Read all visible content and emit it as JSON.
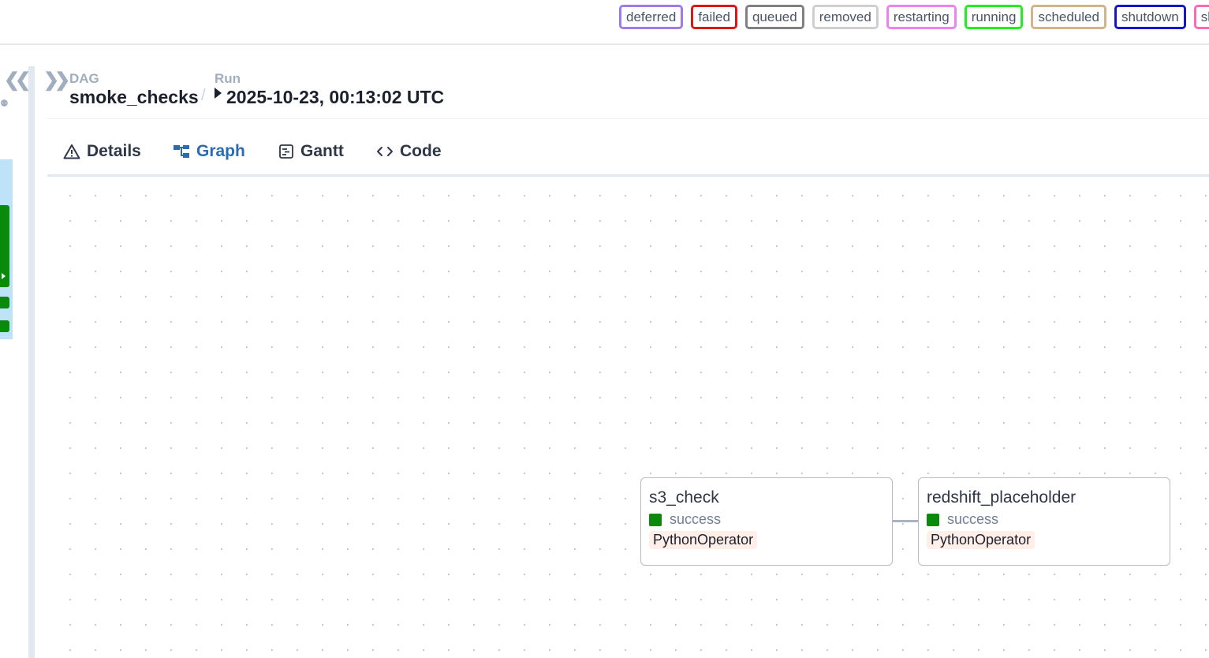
{
  "legend": [
    {
      "label": "deferred",
      "color": "#9f7aea"
    },
    {
      "label": "failed",
      "color": "#e01515"
    },
    {
      "label": "queued",
      "color": "#808080"
    },
    {
      "label": "removed",
      "color": "#cfcfcf"
    },
    {
      "label": "restarting",
      "color": "#ee82ee"
    },
    {
      "label": "running",
      "color": "#22ee22"
    },
    {
      "label": "scheduled",
      "color": "#d2b48c"
    },
    {
      "label": "shutdown",
      "color": "#1515cc"
    },
    {
      "label": "sk",
      "color": "#ff69b4"
    }
  ],
  "breadcrumb": {
    "dag_label": "DAG",
    "dag_id": "smoke_checks",
    "separator": "/",
    "run_label": "Run",
    "run_id": "2025-10-23, 00:13:02 UTC"
  },
  "tabs": [
    {
      "label": "Details",
      "icon": "warning-icon",
      "active": false
    },
    {
      "label": "Graph",
      "icon": "graph-icon",
      "active": true
    },
    {
      "label": "Gantt",
      "icon": "gantt-icon",
      "active": false
    },
    {
      "label": "Code",
      "icon": "code-icon",
      "active": false
    }
  ],
  "graph": {
    "nodes": [
      {
        "task_id": "s3_check",
        "state": "success",
        "operator": "PythonOperator"
      },
      {
        "task_id": "redshift_placeholder",
        "state": "success",
        "operator": "PythonOperator"
      }
    ]
  },
  "colors": {
    "accent": "#2b6cb0",
    "success": "#0a8a0a",
    "operator_bg": "#ffefe8"
  }
}
